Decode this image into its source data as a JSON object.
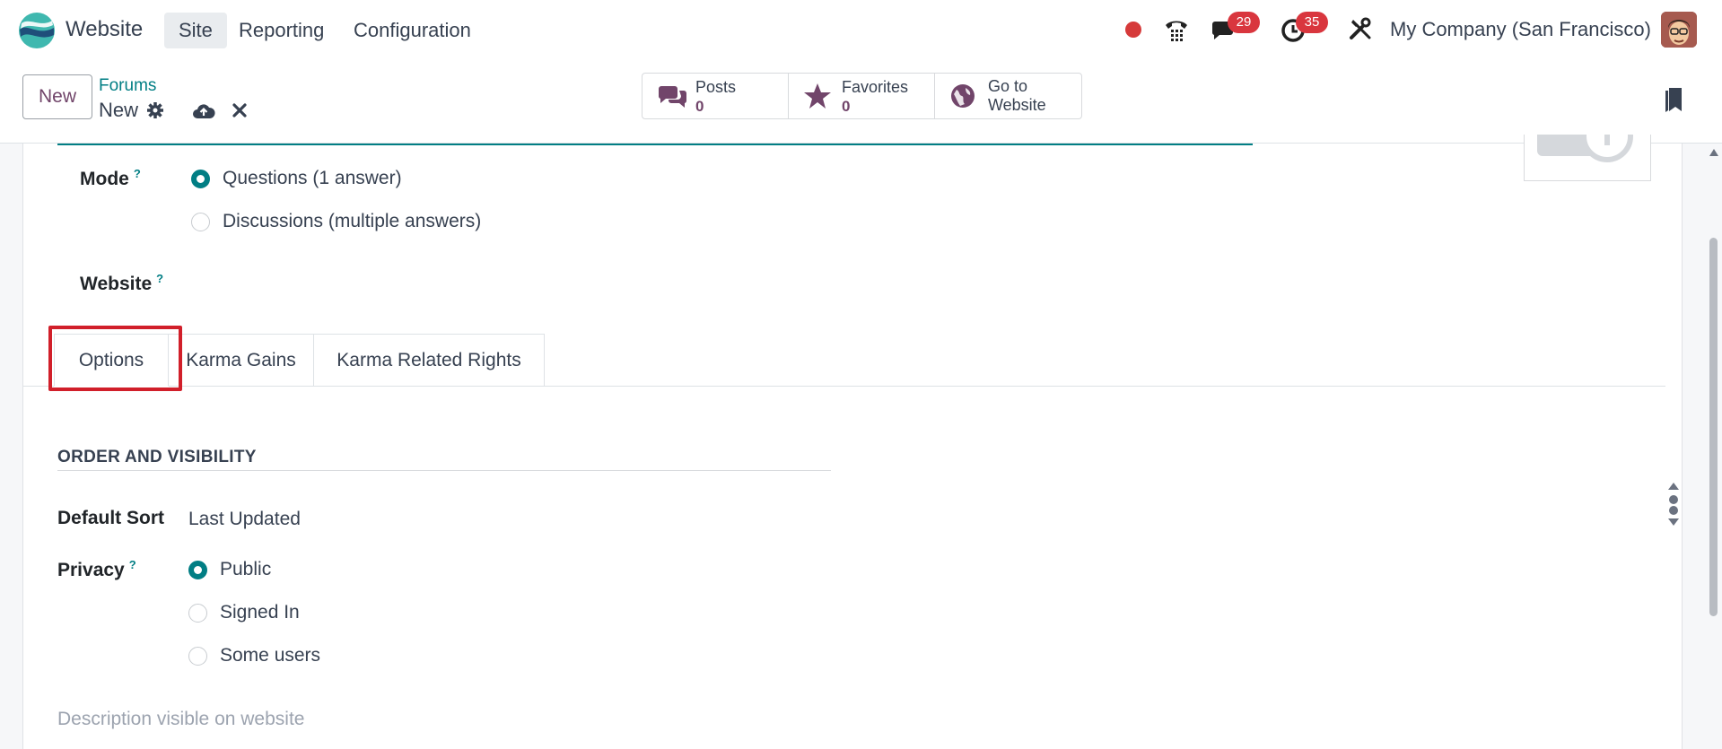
{
  "navbar": {
    "app_name": "Website",
    "menu": [
      "Site",
      "Reporting",
      "Configuration"
    ],
    "active_menu": "Site",
    "chat_count": "29",
    "activity_count": "35",
    "company": "My Company (San Francisco)"
  },
  "control_panel": {
    "new_label": "New",
    "breadcrumb": "Forums",
    "record_name": "New",
    "smart_buttons": [
      {
        "label": "Posts",
        "value": "0",
        "icon": "comments-icon"
      },
      {
        "label": "Favorites",
        "value": "0",
        "icon": "star-icon"
      },
      {
        "label_line1": "Go to",
        "label_line2": "Website",
        "icon": "globe-icon"
      }
    ]
  },
  "form": {
    "mode_label": "Mode",
    "mode_options": [
      "Questions (1 answer)",
      "Discussions (multiple answers)"
    ],
    "mode_selected": "Questions (1 answer)",
    "website_label": "Website",
    "help_mark": "?",
    "tabs": [
      "Options",
      "Karma Gains",
      "Karma Related Rights"
    ],
    "active_tab": "Options",
    "section_title": "ORDER AND VISIBILITY",
    "default_sort_label": "Default Sort",
    "default_sort_value": "Last Updated",
    "privacy_label": "Privacy",
    "privacy_options": [
      "Public",
      "Signed In",
      "Some users"
    ],
    "privacy_selected": "Public",
    "description_placeholder": "Description visible on website"
  },
  "colors": {
    "accent": "#017e84",
    "brand": "#71456a",
    "badge": "#d9363e",
    "highlight": "#d11f2a"
  }
}
